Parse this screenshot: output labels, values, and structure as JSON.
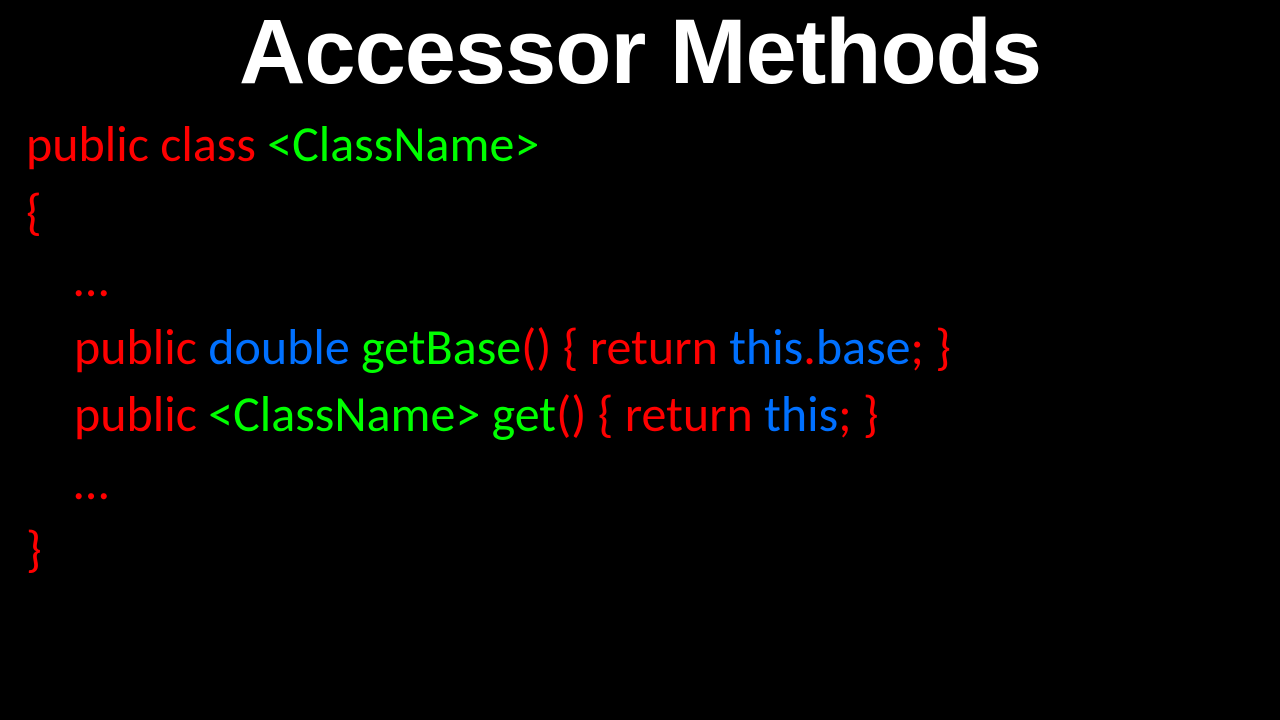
{
  "title": "Accessor Methods",
  "code": {
    "l1": {
      "a": "public class ",
      "b": "<ClassName>"
    },
    "l2": "{",
    "l3": "…",
    "l4": {
      "a": "public ",
      "b": "double ",
      "c": "getBase",
      "d": "() { ",
      "e": "return ",
      "f": "this",
      "g": ".",
      "h": "base",
      "i": "; }"
    },
    "l5": {
      "a": "public ",
      "b": "<ClassName> ",
      "c": "get",
      "d": "() { ",
      "e": "return ",
      "f": "this",
      "g": "; }"
    },
    "l6": "…",
    "l7": "}"
  }
}
